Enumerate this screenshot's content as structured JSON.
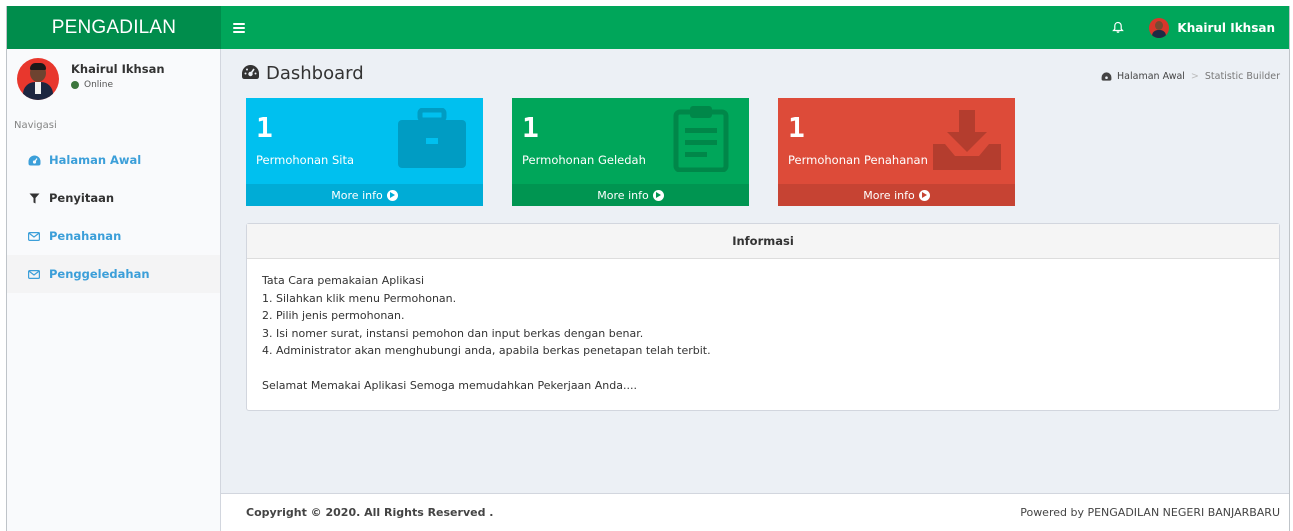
{
  "header": {
    "logo": "PENGADILAN",
    "menu_icon": "hamburger-icon",
    "notification_icon": "bell-icon",
    "user_name": "Khairul Ikhsan"
  },
  "sidebar": {
    "user": {
      "name": "Khairul Ikhsan",
      "status": "Online"
    },
    "nav_header": "Navigasi",
    "items": [
      {
        "label": "Halaman Awal",
        "icon": "dashboard-icon"
      },
      {
        "label": "Penyitaan",
        "icon": "filter-icon"
      },
      {
        "label": "Penahanan",
        "icon": "envelope-icon"
      },
      {
        "label": "Penggeledahan",
        "icon": "envelope-icon"
      }
    ]
  },
  "page": {
    "title": "Dashboard",
    "breadcrumb": {
      "home": "Halaman Awal",
      "current": "Statistic Builder"
    }
  },
  "stat_boxes": [
    {
      "value": "1",
      "label": "Permohonan Sita",
      "footer": "More info",
      "color": "#00c0ef",
      "icon": "briefcase-icon"
    },
    {
      "value": "1",
      "label": "Permohonan Geledah",
      "footer": "More info",
      "color": "#00a65a",
      "icon": "clipboard-icon"
    },
    {
      "value": "1",
      "label": "Permohonan Penahanan",
      "footer": "More info",
      "color": "#dd4b39",
      "icon": "download-tray-icon"
    }
  ],
  "info": {
    "title": "Informasi",
    "lines": [
      "Tata Cara pemakaian Aplikasi",
      "1. Silahkan klik menu Permohonan.",
      "2. Pilih jenis permohonan.",
      "3. Isi nomer surat, instansi pemohon dan input berkas dengan benar.",
      "4. Administrator akan menghubungi anda, apabila berkas penetapan telah terbit."
    ],
    "closing": "Selamat Memakai Aplikasi Semoga memudahkan Pekerjaan Anda...."
  },
  "footer": {
    "copyright": "Copyright © 2020. All Rights Reserved .",
    "powered": "Powered by PENGADILAN NEGERI BANJARBARU"
  }
}
